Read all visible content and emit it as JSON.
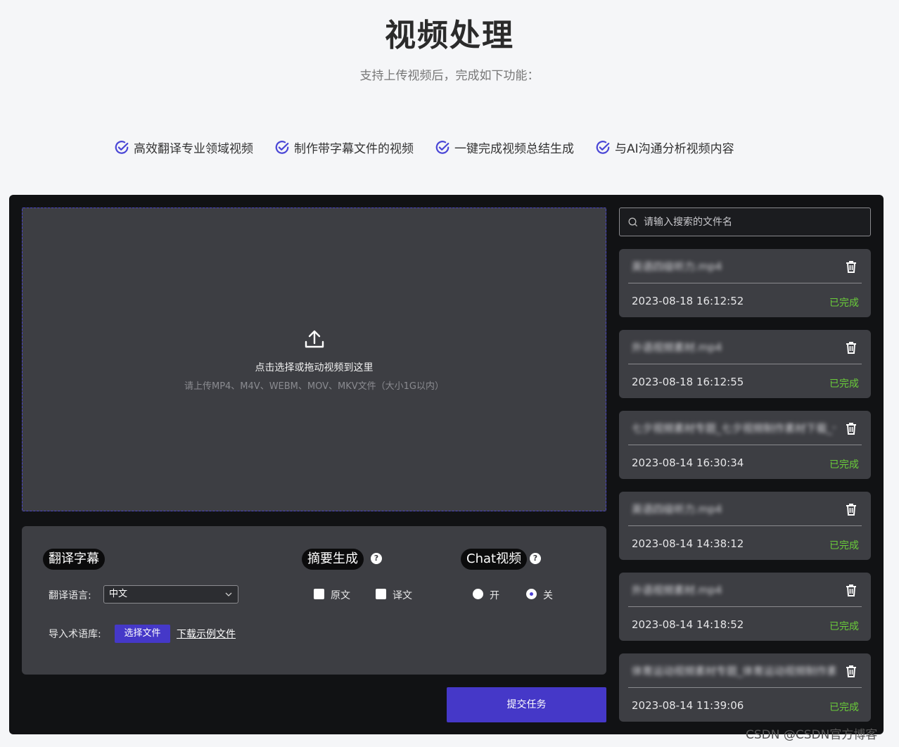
{
  "header": {
    "title": "视频处理",
    "subtitle": "支持上传视频后，完成如下功能："
  },
  "features": [
    "高效翻译专业领域视频",
    "制作带字幕文件的视频",
    "一键完成视频总结生成",
    "与AI沟通分析视频内容"
  ],
  "upload": {
    "title": "点击选择或拖动视频到这里",
    "hint": "请上传MP4、M4V、WEBM、MOV、MKV文件（大小1G以内）"
  },
  "options": {
    "translate": {
      "title": "翻译字幕",
      "language_label": "翻译语言:",
      "language_value": "中文",
      "glossary_label": "导入术语库:",
      "choose_file": "选择文件",
      "download_sample": "下载示例文件"
    },
    "summary": {
      "title": "摘要生成",
      "help": "?",
      "original": "原文",
      "translation": "译文"
    },
    "chat": {
      "title": "Chat视频",
      "help": "?",
      "on": "开",
      "off": "关",
      "selected": "off"
    }
  },
  "submit_label": "提交任务",
  "search": {
    "placeholder": "请输入搜索的文件名"
  },
  "files": [
    {
      "name": "英语四级听力.mp4",
      "time": "2023-08-18 16:12:52",
      "status": "已完成"
    },
    {
      "name": "外语视频素材.mp4",
      "time": "2023-08-18 16:12:55",
      "status": "已完成"
    },
    {
      "name": "七夕视频素材专题_七夕视频制作素材下载_七夕",
      "time": "2023-08-14 16:30:34",
      "status": "已完成"
    },
    {
      "name": "英语四级听力.mp4",
      "time": "2023-08-14 14:38:12",
      "status": "已完成"
    },
    {
      "name": "外语视频素材.mp4",
      "time": "2023-08-14 14:18:52",
      "status": "已完成"
    },
    {
      "name": "体育运动视频素材专题_体育运动视频制作素材下载",
      "time": "2023-08-14 11:39:06",
      "status": "已完成"
    }
  ],
  "watermark": "CSDN @CSDN官方博客",
  "colors": {
    "accent": "#4538c8",
    "success": "#6acd3a",
    "panel": "#111214",
    "card": "#3d3e43"
  }
}
